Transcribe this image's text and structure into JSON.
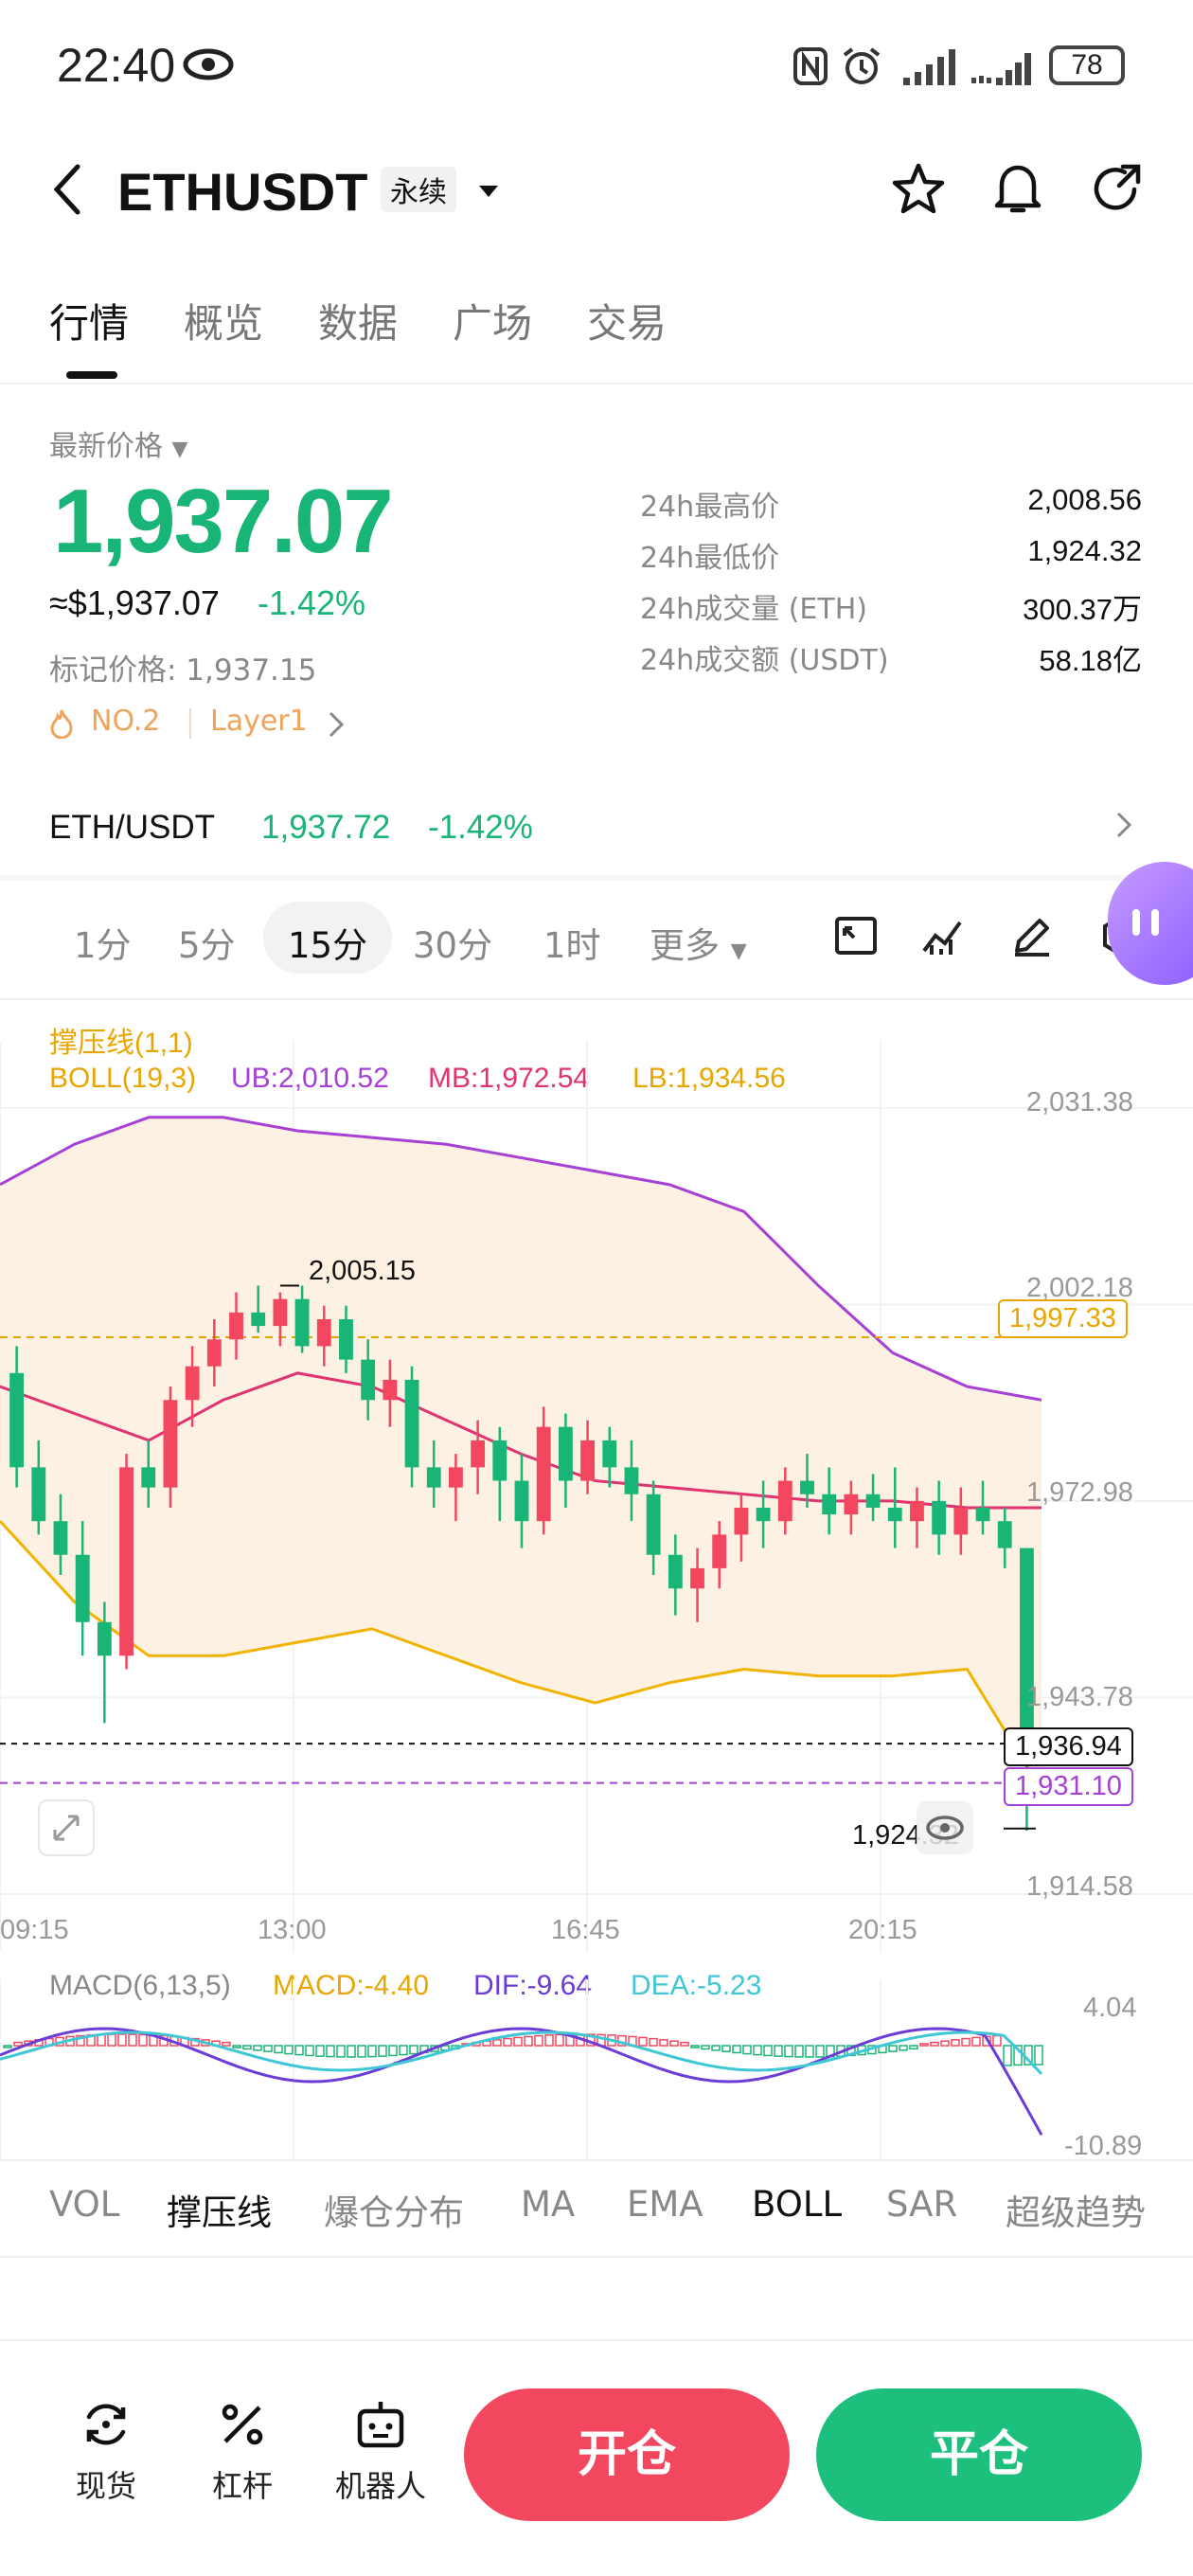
{
  "status_bar": {
    "time": "22:40",
    "battery": "78"
  },
  "header": {
    "symbol": "ETHUSDT",
    "badge": "永续"
  },
  "tabs": [
    {
      "label": "行情",
      "active": true
    },
    {
      "label": "概览",
      "active": false
    },
    {
      "label": "数据",
      "active": false
    },
    {
      "label": "广场",
      "active": false
    },
    {
      "label": "交易",
      "active": false
    }
  ],
  "price": {
    "latest_label": "最新价格",
    "last": "1,937.07",
    "usd": "≈$1,937.07",
    "change": "-1.42%",
    "mark": "标记价格: 1,937.15",
    "rank": "NO.2",
    "layer": "Layer1"
  },
  "stats": [
    {
      "label": "24h最高价",
      "value": "2,008.56"
    },
    {
      "label": "24h最低价",
      "value": "1,924.32"
    },
    {
      "label": "24h成交量 (ETH)",
      "value": "300.37万"
    },
    {
      "label": "24h成交额 (USDT)",
      "value": "58.18亿"
    }
  ],
  "pair": {
    "name": "ETH/USDT",
    "price": "1,937.72",
    "change": "-1.42%"
  },
  "intervals": [
    "1分",
    "5分",
    "15分",
    "30分",
    "1时",
    "更多"
  ],
  "active_interval": "15分",
  "legend": {
    "support": "撑压线(1,1)",
    "boll": "BOLL(19,3)",
    "ub": "UB:2,010.52",
    "mb": "MB:1,972.54",
    "lb": "LB:1,934.56",
    "macd_title": "MACD(6,13,5)",
    "macd": "MACD:-4.40",
    "dif": "DIF:-9.64",
    "dea": "DEA:-5.23"
  },
  "axis": {
    "y": [
      "2,031.38",
      "2,002.18",
      "1,972.98",
      "1,943.78",
      "1,914.58"
    ],
    "x": [
      "09:15",
      "13:00",
      "16:45",
      "20:15"
    ],
    "macd_y": [
      "4.04",
      "-10.89"
    ]
  },
  "price_tags": {
    "high": "2,005.15",
    "low": "1,924.32",
    "resistance": "1,997.33",
    "current": "1,936.94",
    "support": "1,931.10"
  },
  "colors": {
    "up": "#19b576",
    "down": "#f3475f",
    "ub": "#a640d6",
    "mb": "#e0336f",
    "lb": "#f0b400"
  },
  "chart_data": {
    "type": "candlestick",
    "ohlc": [
      [
        1992,
        1996,
        1975,
        1978
      ],
      [
        1978,
        1982,
        1968,
        1970
      ],
      [
        1970,
        1974,
        1962,
        1965
      ],
      [
        1965,
        1970,
        1950,
        1955
      ],
      [
        1955,
        1958,
        1940,
        1950
      ],
      [
        1950,
        1980,
        1948,
        1978
      ],
      [
        1978,
        1982,
        1972,
        1975
      ],
      [
        1975,
        1990,
        1972,
        1988
      ],
      [
        1988,
        1996,
        1984,
        1993
      ],
      [
        1993,
        2000,
        1990,
        1997
      ],
      [
        1997,
        2004,
        1994,
        2001
      ],
      [
        2001,
        2005,
        1998,
        1999
      ],
      [
        1999,
        2004,
        1996,
        2003
      ],
      [
        2003,
        2005,
        1995,
        1996
      ],
      [
        1996,
        2002,
        1993,
        2000
      ],
      [
        2000,
        2002,
        1992,
        1994
      ],
      [
        1994,
        1997,
        1985,
        1988
      ],
      [
        1988,
        1994,
        1984,
        1991
      ],
      [
        1991,
        1993,
        1975,
        1978
      ],
      [
        1978,
        1982,
        1972,
        1975
      ],
      [
        1975,
        1980,
        1970,
        1978
      ],
      [
        1978,
        1985,
        1974,
        1982
      ],
      [
        1982,
        1984,
        1970,
        1976
      ],
      [
        1976,
        1980,
        1966,
        1970
      ],
      [
        1970,
        1987,
        1968,
        1984
      ],
      [
        1984,
        1986,
        1972,
        1976
      ],
      [
        1976,
        1985,
        1974,
        1982
      ],
      [
        1982,
        1984,
        1975,
        1978
      ],
      [
        1978,
        1982,
        1970,
        1974
      ],
      [
        1974,
        1976,
        1962,
        1965
      ],
      [
        1965,
        1968,
        1956,
        1960
      ],
      [
        1960,
        1966,
        1955,
        1963
      ],
      [
        1963,
        1970,
        1960,
        1968
      ],
      [
        1968,
        1974,
        1964,
        1972
      ],
      [
        1972,
        1976,
        1966,
        1970
      ],
      [
        1970,
        1978,
        1968,
        1976
      ],
      [
        1976,
        1980,
        1972,
        1974
      ],
      [
        1974,
        1978,
        1968,
        1971
      ],
      [
        1971,
        1976,
        1968,
        1974
      ],
      [
        1974,
        1977,
        1970,
        1972
      ],
      [
        1972,
        1978,
        1966,
        1970
      ],
      [
        1970,
        1975,
        1966,
        1973
      ],
      [
        1973,
        1976,
        1965,
        1968
      ],
      [
        1968,
        1975,
        1965,
        1972
      ],
      [
        1972,
        1976,
        1968,
        1970
      ],
      [
        1970,
        1972,
        1963,
        1966
      ],
      [
        1966,
        1940,
        1924,
        1936
      ]
    ],
    "boll_ub": [
      2020,
      2026,
      2030,
      2030,
      2028,
      2027,
      2026,
      2024,
      2022,
      2020,
      2016,
      2005,
      1995,
      1990,
      1988
    ],
    "boll_mb": [
      1990,
      1986,
      1982,
      1988,
      1992,
      1990,
      1985,
      1980,
      1976,
      1975,
      1974,
      1973,
      1973,
      1972,
      1972
    ],
    "boll_lb": [
      1970,
      1958,
      1950,
      1950,
      1952,
      1954,
      1950,
      1946,
      1943,
      1946,
      1948,
      1947,
      1947,
      1948,
      1930
    ],
    "ylim": [
      1914.58,
      2031.38
    ],
    "x_ticks": [
      "09:15",
      "13:00",
      "16:45",
      "20:15"
    ]
  },
  "indicator_tabs": [
    {
      "label": "VOL",
      "on": false
    },
    {
      "label": "撑压线",
      "on": true
    },
    {
      "label": "爆仓分布",
      "on": false
    },
    {
      "label": "MA",
      "on": false
    },
    {
      "label": "EMA",
      "on": false
    },
    {
      "label": "BOLL",
      "on": true
    },
    {
      "label": "SAR",
      "on": false
    },
    {
      "label": "超级趋势",
      "on": false
    }
  ],
  "bottom_nav": {
    "spot": "现货",
    "leverage": "杠杆",
    "robot": "机器人",
    "open": "开仓",
    "close": "平仓"
  }
}
